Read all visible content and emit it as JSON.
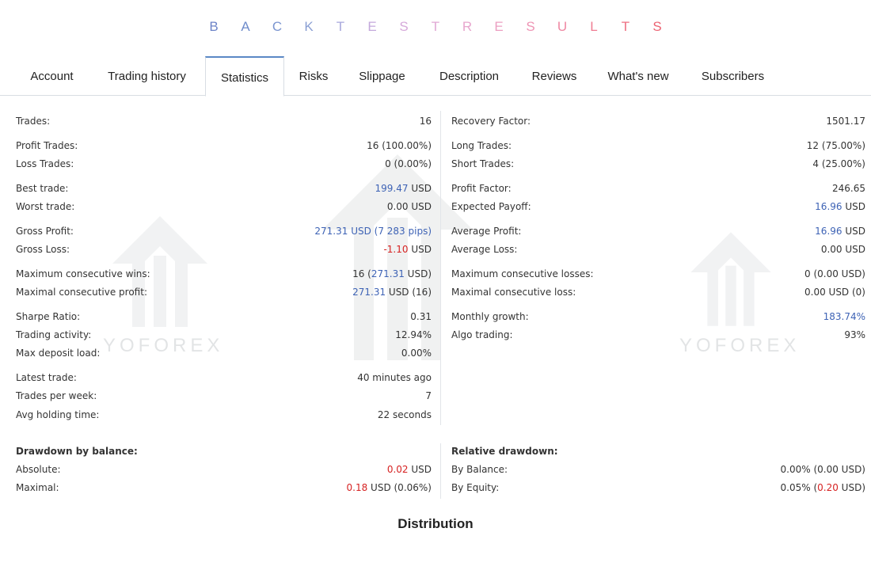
{
  "title": {
    "letters": [
      "B",
      "A",
      "C",
      "K",
      "T",
      "E",
      "S",
      "T",
      "R",
      "E",
      "S",
      "U",
      "L",
      "T",
      "S"
    ],
    "colors": [
      "#6d84c8",
      "#6f8ccb",
      "#7b95d0",
      "#8a9fd3",
      "#a8a8dc",
      "#c4a9dc",
      "#d6a9da",
      "#e0a8d5",
      "#e7a6cd",
      "#ec9fc2",
      "#ee94b4",
      "#ef88a3",
      "#ef7c92",
      "#ee6f82",
      "#ec6373"
    ]
  },
  "tabs": [
    {
      "label": "Account",
      "active": false
    },
    {
      "label": "Trading history",
      "active": false
    },
    {
      "label": "Statistics",
      "active": true
    },
    {
      "label": "Risks",
      "active": false
    },
    {
      "label": "Slippage",
      "active": false
    },
    {
      "label": "Description",
      "active": false
    },
    {
      "label": "Reviews",
      "active": false
    },
    {
      "label": "What's new",
      "active": false
    },
    {
      "label": "Subscribers",
      "active": false
    }
  ],
  "watermark": {
    "brand": "YOFOREX"
  },
  "stats_left": [
    {
      "label": "Trades:",
      "value": [
        {
          "t": "16"
        }
      ]
    },
    {
      "label": "Profit Trades:",
      "value": [
        {
          "t": "16 (100.00%)"
        }
      ]
    },
    {
      "label": "Loss Trades:",
      "value": [
        {
          "t": "0 (0.00%)"
        }
      ]
    },
    {
      "label": "Best trade:",
      "value": [
        {
          "t": "199.47",
          "c": "blue"
        },
        {
          "t": " USD"
        }
      ]
    },
    {
      "label": "Worst trade:",
      "value": [
        {
          "t": "0.00 USD"
        }
      ]
    },
    {
      "label": "Gross Profit:",
      "value": [
        {
          "t": "271.31 USD (7 283 pips)",
          "c": "blue"
        }
      ]
    },
    {
      "label": "Gross Loss:",
      "value": [
        {
          "t": "-1.10",
          "c": "red"
        },
        {
          "t": " USD"
        }
      ]
    },
    {
      "label": "Maximum consecutive wins:",
      "value": [
        {
          "t": "16 ("
        },
        {
          "t": "271.31",
          "c": "blue"
        },
        {
          "t": " USD)"
        }
      ]
    },
    {
      "label": "Maximal consecutive profit:",
      "value": [
        {
          "t": "271.31",
          "c": "blue"
        },
        {
          "t": " USD (16)"
        }
      ]
    },
    {
      "label": "Sharpe Ratio:",
      "value": [
        {
          "t": "0.31"
        }
      ]
    },
    {
      "label": "Trading activity:",
      "value": [
        {
          "t": "12.94%"
        }
      ]
    },
    {
      "label": "Max deposit load:",
      "value": [
        {
          "t": "0.00%"
        }
      ]
    },
    {
      "label": "Latest trade:",
      "value": [
        {
          "t": "40 minutes ago"
        }
      ]
    },
    {
      "label": "Trades per week:",
      "value": [
        {
          "t": "7"
        }
      ]
    },
    {
      "label": "Avg holding time:",
      "value": [
        {
          "t": "22 seconds"
        }
      ]
    }
  ],
  "stats_right": [
    {
      "label": "Recovery Factor:",
      "value": [
        {
          "t": "1501.17"
        }
      ]
    },
    {
      "label": "Long Trades:",
      "value": [
        {
          "t": "12 (75.00%)"
        }
      ]
    },
    {
      "label": "Short Trades:",
      "value": [
        {
          "t": "4 (25.00%)"
        }
      ]
    },
    {
      "label": "Profit Factor:",
      "value": [
        {
          "t": "246.65"
        }
      ]
    },
    {
      "label": "Expected Payoff:",
      "value": [
        {
          "t": "16.96",
          "c": "blue"
        },
        {
          "t": " USD"
        }
      ]
    },
    {
      "label": "Average Profit:",
      "value": [
        {
          "t": "16.96",
          "c": "blue"
        },
        {
          "t": " USD"
        }
      ]
    },
    {
      "label": "Average Loss:",
      "value": [
        {
          "t": "0.00 USD"
        }
      ]
    },
    {
      "label": "Maximum consecutive losses:",
      "value": [
        {
          "t": "0 (0.00 USD)"
        }
      ]
    },
    {
      "label": "Maximal consecutive loss:",
      "value": [
        {
          "t": "0.00 USD (0)"
        }
      ]
    },
    {
      "label": "Monthly growth:",
      "value": [
        {
          "t": "183.74%",
          "c": "blue"
        }
      ]
    },
    {
      "label": "Algo trading:",
      "value": [
        {
          "t": "93%"
        }
      ]
    }
  ],
  "drawdown_balance": {
    "heading": "Drawdown by balance:",
    "rows": [
      {
        "label": "Absolute:",
        "value": [
          {
            "t": "0.02",
            "c": "red"
          },
          {
            "t": " USD"
          }
        ]
      },
      {
        "label": "Maximal:",
        "value": [
          {
            "t": "0.18",
            "c": "red"
          },
          {
            "t": " USD (0.06%)"
          }
        ]
      }
    ]
  },
  "relative_drawdown": {
    "heading": "Relative drawdown:",
    "rows": [
      {
        "label": "By Balance:",
        "value": [
          {
            "t": "0.00% (0.00 USD)"
          }
        ]
      },
      {
        "label": "By Equity:",
        "value": [
          {
            "t": "0.05% ("
          },
          {
            "t": "0.20",
            "c": "red"
          },
          {
            "t": " USD)"
          }
        ]
      }
    ]
  },
  "distribution_heading": "Distribution"
}
